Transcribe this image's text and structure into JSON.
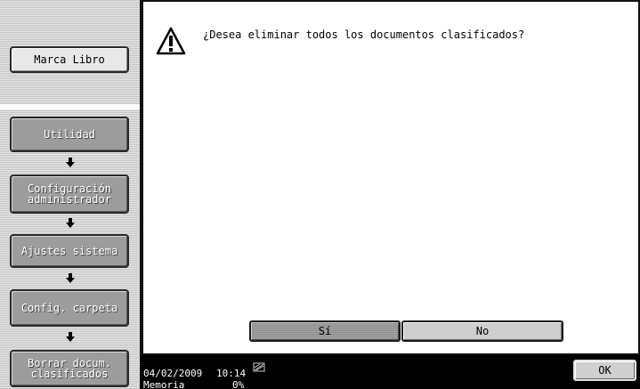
{
  "sidebar": {
    "bookmark_label": "Marca Libro",
    "path": [
      "Utilidad",
      "Configuración\nadministrador",
      "Ajustes sistema",
      "Config. carpeta",
      "Borrar docum.\nclasificados"
    ]
  },
  "dialog": {
    "icon": "warning-icon",
    "message": "¿Desea eliminar todos los documentos clasificados?",
    "yes_label": "Sí",
    "no_label": "No"
  },
  "status": {
    "date": "04/02/2009",
    "time": "10:14",
    "memory_label": "Memoria",
    "memory_value": "0%",
    "network_icon": "network-icon",
    "ok_label": "OK"
  }
}
